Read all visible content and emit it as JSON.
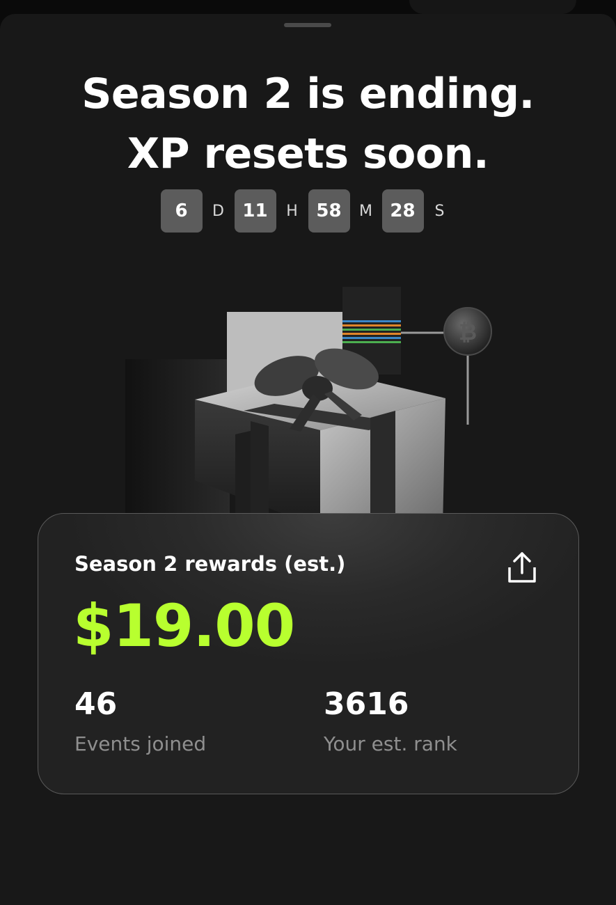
{
  "headline": {
    "line1": "Season 2 is ending.",
    "line2": "XP resets soon."
  },
  "countdown": [
    {
      "value": "6",
      "unit": "D"
    },
    {
      "value": "11",
      "unit": "H"
    },
    {
      "value": "58",
      "unit": "M"
    },
    {
      "value": "28",
      "unit": "S"
    }
  ],
  "illustration": {
    "subject": "gift-box",
    "coin_icon": "bitcoin-icon"
  },
  "rewards_card": {
    "title": "Season 2 rewards (est.)",
    "amount": "$19.00",
    "share_icon": "share-icon",
    "stats": [
      {
        "value": "46",
        "label": "Events joined"
      },
      {
        "value": "3616",
        "label": "Your est. rank"
      }
    ]
  },
  "colors": {
    "accent": "#b8ff2f",
    "sheet_background": "#181818",
    "card_background": "#2a2a2a",
    "countdown_box": "#5c5c5c"
  }
}
